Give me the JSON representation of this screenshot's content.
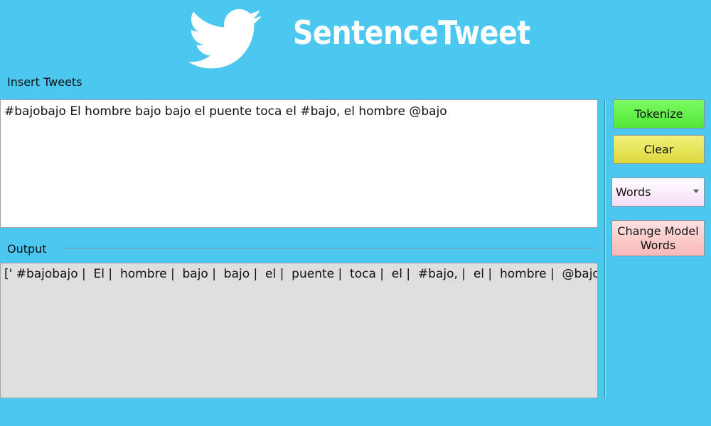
{
  "header": {
    "logo_icon": "twitter-bird-icon",
    "title": "SentenceTweet"
  },
  "input": {
    "label": "Insert Tweets",
    "value": "#bajobajo El hombre bajo bajo el puente toca el #bajo, el hombre @bajo"
  },
  "output": {
    "label": "Output",
    "value": "[' #bajobajo |  El |  hombre |  bajo |  bajo |  el |  puente |  toca |  el |  #bajo, |  el |  hombre |  @bajo']"
  },
  "controls": {
    "tokenize_label": "Tokenize",
    "clear_label": "Clear",
    "model_select": {
      "selected": "Words"
    },
    "change_model_line1": "Change Model",
    "change_model_line2": "Words"
  },
  "colors": {
    "background": "#4cc8f0",
    "tokenize": "#64f04a",
    "clear": "#e8e65a",
    "change_model": "#fbc8c8"
  }
}
